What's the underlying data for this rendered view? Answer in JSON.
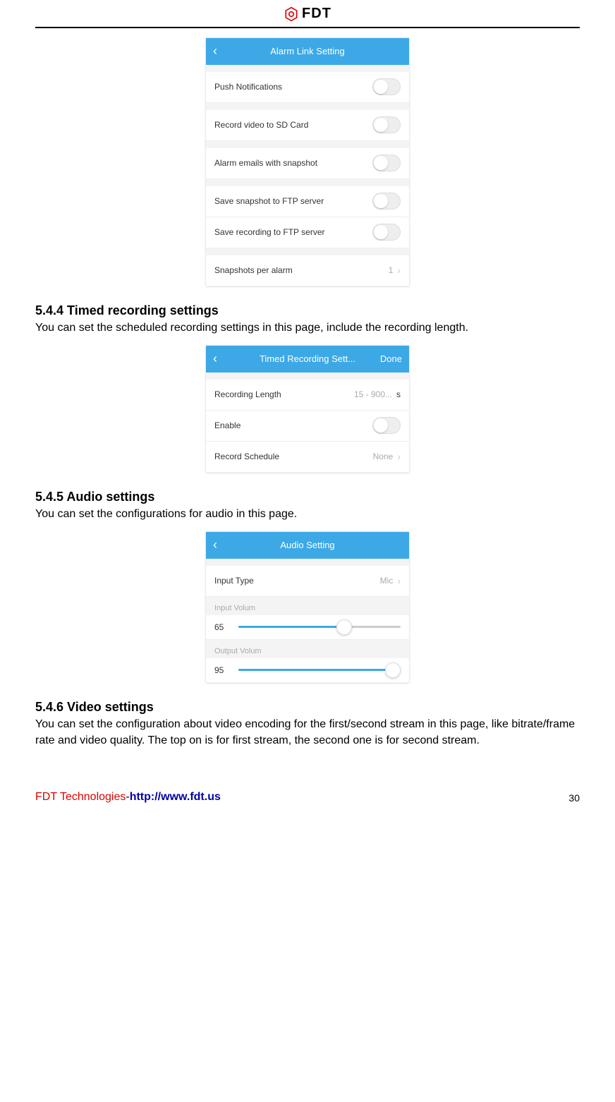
{
  "logo": {
    "text": "FDT"
  },
  "screenshot1": {
    "title": "Alarm Link Setting",
    "rows": {
      "push": "Push Notifications",
      "recsd": "Record video to SD Card",
      "emails": "Alarm emails with snapshot",
      "snapftp": "Save snapshot to FTP server",
      "recftp": "Save recording to FTP server",
      "snapper": "Snapshots per alarm",
      "snapper_val": "1"
    }
  },
  "section544": {
    "heading": "5.4.4 Timed recording settings",
    "body": "You can set the scheduled recording settings in this page, include the recording length."
  },
  "screenshot2": {
    "title": "Timed Recording Sett...",
    "done": "Done",
    "rows": {
      "reclen": "Recording Length",
      "reclen_val": "15 - 900...",
      "reclen_unit": "s",
      "enable": "Enable",
      "sched": "Record Schedule",
      "sched_val": "None"
    }
  },
  "section545": {
    "heading": "5.4.5 Audio settings",
    "body": "You can set the configurations for audio in this page."
  },
  "screenshot3": {
    "title": "Audio Setting",
    "rows": {
      "inputtype": "Input Type",
      "inputtype_val": "Mic",
      "inputvol_label": "Input Volum",
      "inputvol_val": "65",
      "outputvol_label": "Output Volum",
      "outputvol_val": "95"
    }
  },
  "section546": {
    "heading": "5.4.6 Video settings",
    "body": "You can set the configuration about video encoding for the first/second stream in this page, like bitrate/frame rate and video quality. The top on is for first stream, the second one is for second stream."
  },
  "footer": {
    "company": "FDT Technologies",
    "dash": "-",
    "proto": "http://",
    "url": "www.fdt.us",
    "page": "30"
  }
}
